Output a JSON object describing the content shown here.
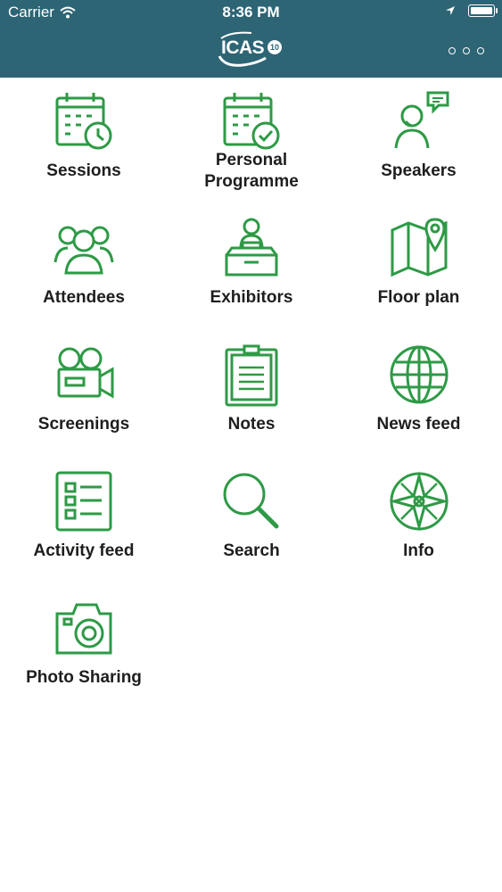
{
  "status_bar": {
    "carrier": "Carrier",
    "time": "8:36 PM"
  },
  "header": {
    "logo_text": "ICAS",
    "logo_badge": "10",
    "more_icon": "more-horizontal-icon",
    "bar_color": "#2d6575"
  },
  "accent_color": "#2e9a46",
  "menu": [
    {
      "label": "Sessions",
      "icon": "calendar-clock-icon"
    },
    {
      "label": "Personal\nProgramme",
      "icon": "calendar-check-icon"
    },
    {
      "label": "Speakers",
      "icon": "speaker-bubble-icon"
    },
    {
      "label": "Attendees",
      "icon": "people-group-icon"
    },
    {
      "label": "Exhibitors",
      "icon": "exhibitor-booth-icon"
    },
    {
      "label": "Floor plan",
      "icon": "map-pin-icon"
    },
    {
      "label": "Screenings",
      "icon": "video-camera-icon"
    },
    {
      "label": "Notes",
      "icon": "clipboard-icon"
    },
    {
      "label": "News feed",
      "icon": "globe-icon"
    },
    {
      "label": "Activity feed",
      "icon": "list-icon"
    },
    {
      "label": "Search",
      "icon": "search-icon"
    },
    {
      "label": "Info",
      "icon": "compass-icon"
    },
    {
      "label": "Photo Sharing",
      "icon": "camera-icon"
    }
  ]
}
